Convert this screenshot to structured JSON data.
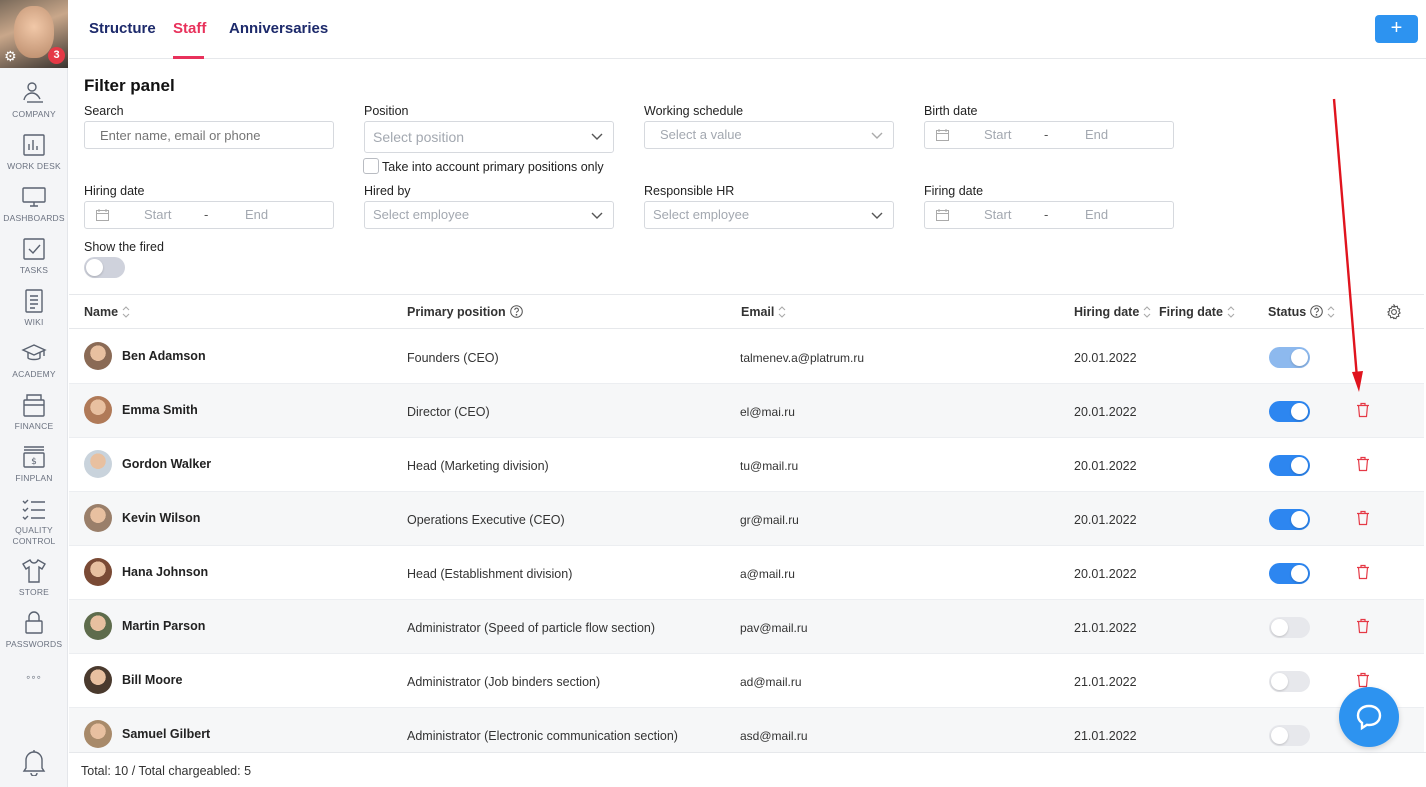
{
  "user": {
    "notification_count": "3"
  },
  "sidebar": {
    "items": [
      {
        "label": "COMPANY",
        "icon": "company-icon"
      },
      {
        "label": "WORK DESK",
        "icon": "chart-icon"
      },
      {
        "label": "DASHBOARDS",
        "icon": "monitor-icon"
      },
      {
        "label": "TASKS",
        "icon": "checkbox-icon"
      },
      {
        "label": "WIKI",
        "icon": "document-icon"
      },
      {
        "label": "ACADEMY",
        "icon": "graduation-cap-icon"
      },
      {
        "label": "FINANCE",
        "icon": "wallet-icon"
      },
      {
        "label": "FINPLAN",
        "icon": "money-icon"
      },
      {
        "label": "QUALITY CONTROL",
        "icon": "checklist-icon"
      },
      {
        "label": "STORE",
        "icon": "tshirt-icon"
      },
      {
        "label": "PASSWORDS",
        "icon": "lock-icon"
      }
    ],
    "more": "◦◦◦"
  },
  "tabs": {
    "structure": "Structure",
    "staff": "Staff",
    "anniversaries": "Anniversaries",
    "add": "+"
  },
  "filter": {
    "title": "Filter panel",
    "search_label": "Search",
    "search_placeholder": "Enter name, email or phone",
    "position_label": "Position",
    "position_placeholder": "Select position",
    "primary_only": "Take into account primary positions only",
    "schedule_label": "Working schedule",
    "schedule_placeholder": "Select a value",
    "birth_label": "Birth date",
    "hiring_label": "Hiring date",
    "hired_by_label": "Hired by",
    "hired_by_placeholder": "Select employee",
    "hr_label": "Responsible HR",
    "hr_placeholder": "Select employee",
    "firing_label": "Firing date",
    "start": "Start",
    "dash": "-",
    "end": "End",
    "show_fired_label": "Show the fired"
  },
  "table": {
    "headers": {
      "name": "Name",
      "position": "Primary position",
      "email": "Email",
      "hiring": "Hiring date",
      "firing": "Firing date",
      "status": "Status"
    },
    "rows": [
      {
        "name": "Ben Adamson",
        "position": "Founders (CEO)",
        "email": "talmenev.a@platrum.ru",
        "hiring": "20.01.2022",
        "status": "on-locked"
      },
      {
        "name": "Emma Smith",
        "position": "Director (CEO)",
        "email": "el@mai.ru",
        "hiring": "20.01.2022",
        "status": "on"
      },
      {
        "name": "Gordon Walker",
        "position": "Head (Marketing division)",
        "email": "tu@mail.ru",
        "hiring": "20.01.2022",
        "status": "on"
      },
      {
        "name": "Kevin Wilson",
        "position": "Operations Executive (CEO)",
        "email": "gr@mail.ru",
        "hiring": "20.01.2022",
        "status": "on"
      },
      {
        "name": "Hana Johnson",
        "position": "Head (Establishment division)",
        "email": "a@mail.ru",
        "hiring": "20.01.2022",
        "status": "on"
      },
      {
        "name": "Martin Parson",
        "position": "Administrator (Speed of particle flow section)",
        "email": "pav@mail.ru",
        "hiring": "21.01.2022",
        "status": "off"
      },
      {
        "name": "Bill Moore",
        "position": "Administrator (Job binders section)",
        "email": "ad@mail.ru",
        "hiring": "21.01.2022",
        "status": "off"
      },
      {
        "name": "Samuel Gilbert",
        "position": "Administrator (Electronic communication section)",
        "email": "asd@mail.ru",
        "hiring": "21.01.2022",
        "status": "off"
      }
    ]
  },
  "footer": {
    "total": "Total: 10 / Total chargeabled: 5"
  },
  "colors": {
    "accent": "#2d86f0",
    "active_tab": "#e8315b",
    "delete": "#e53946",
    "annotation_arrow": "#e0141e"
  }
}
